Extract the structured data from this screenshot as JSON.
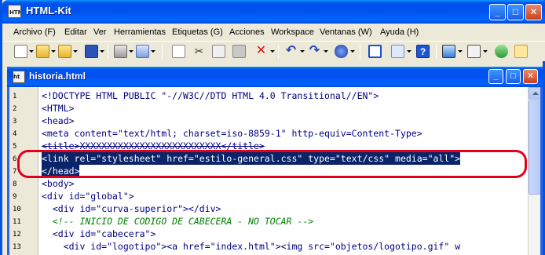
{
  "app": {
    "title": "HTML-Kit"
  },
  "menubar": {
    "items": [
      "Archivo (F)",
      "Editar",
      "Ver",
      "Herramientas",
      "Etiquetas (G)",
      "Acciones",
      "Workspace",
      "Ventanas (W)",
      "Ayuda (H)"
    ]
  },
  "toolbar": {
    "icons": [
      "new-file-icon",
      "open-folder-icon",
      "open-folder-alt-icon",
      "save-icon",
      "print-icon",
      "preview-icon",
      "copy-icon",
      "cut-icon",
      "paste-icon",
      "paste-alt-icon",
      "delete-icon",
      "undo-icon",
      "redo-icon",
      "find-icon",
      "split-view-icon",
      "tree-icon",
      "help-icon",
      "monitor-icon",
      "toggle-icon",
      "plugin-icon",
      "window-icon"
    ]
  },
  "document": {
    "title": "historia.html",
    "line_numbers": [
      "1",
      "2",
      "3",
      "4",
      "5",
      "6",
      "7",
      "8",
      "9",
      "10",
      "11",
      "12",
      "13"
    ],
    "lines": [
      "<!DOCTYPE HTML PUBLIC \"-//W3C//DTD HTML 4.0 Transitional//EN\">",
      "<HTML>",
      "<head>",
      "<meta content=\"text/html; charset=iso-8859-1\" http-equiv=Content-Type>",
      "<title>XXXXXXXXXXXXXXXXXXXXXXXXXX</title>",
      "<link rel=\"stylesheet\" href=\"estilo-general.css\" type=\"text/css\" media=\"all\">",
      "</head>",
      "<body>",
      "<div id=\"global\">",
      "  <div id=\"curva-superior\"></div>",
      "  <!-- INICIO DE CODIGO DE CABECERA - NO TOCAR -->",
      "  <div id=\"cabecera\">",
      "    <div id=\"logotipo\"><a href=\"index.html\"><img src=\"objetos/logotipo.gif\" w"
    ]
  },
  "colors": {
    "titlebar": "#0054e3",
    "selection": "#0a246a",
    "callout": "#e3001b"
  }
}
